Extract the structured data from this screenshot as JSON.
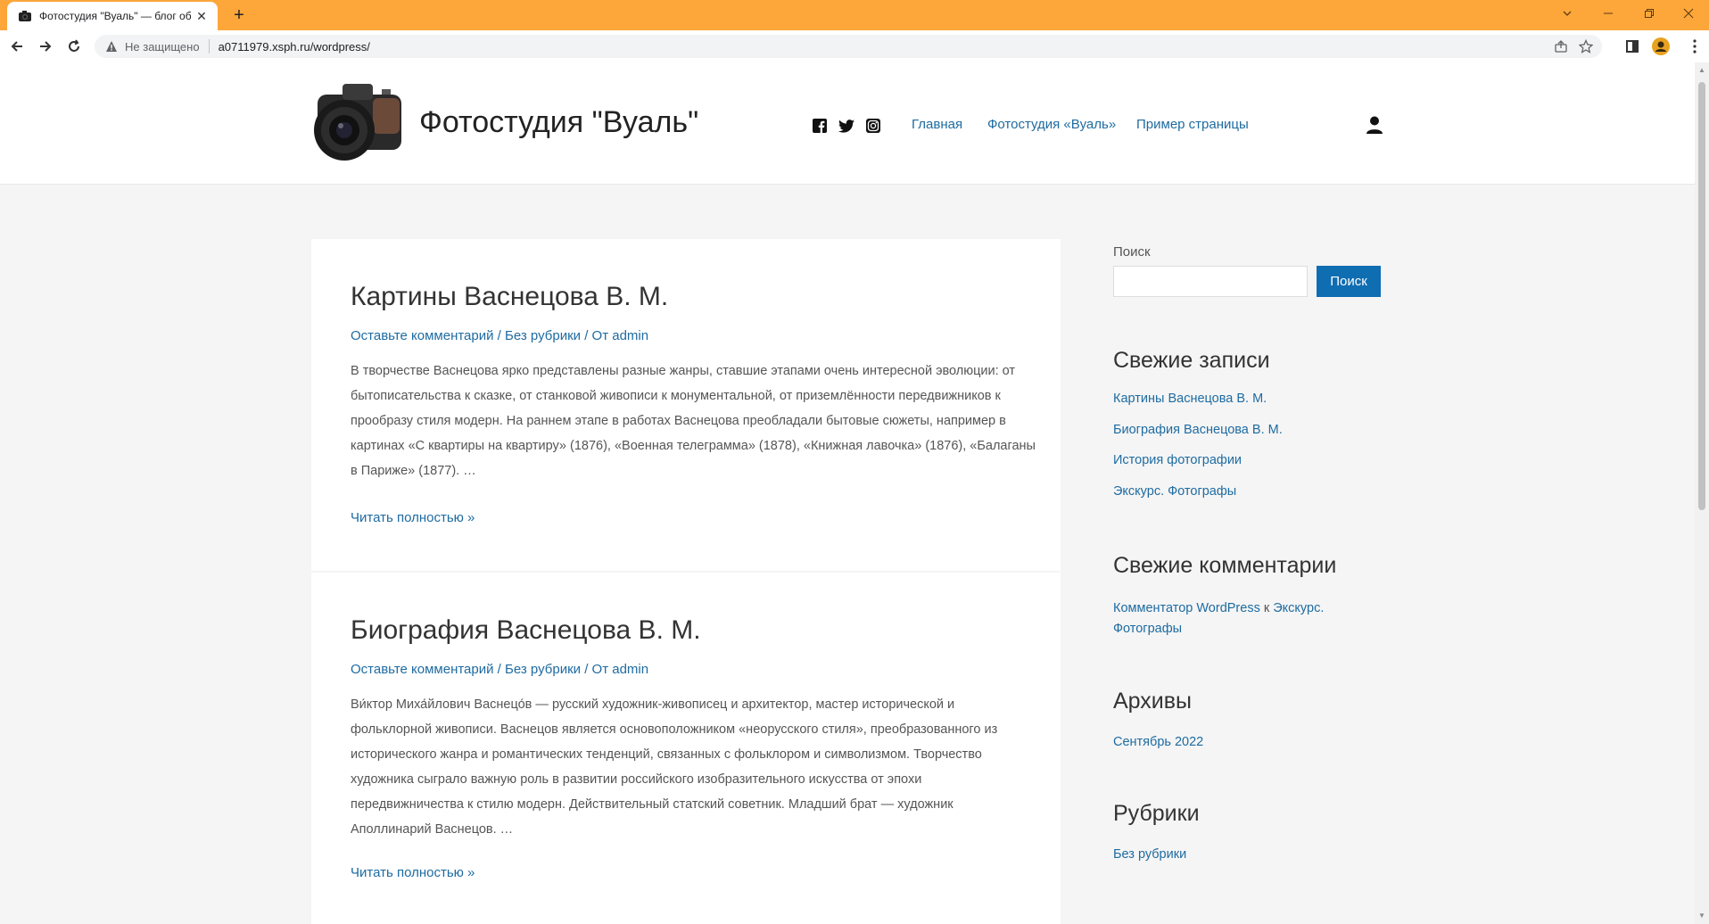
{
  "browser": {
    "tab_title": "Фотостудия \"Вуаль\" — блог об",
    "security_text": "Не защищено",
    "url": "a0711979.xsph.ru/wordpress/"
  },
  "site": {
    "title": "Фотостудия \"Вуаль\"",
    "menu": [
      {
        "label": "Главная"
      },
      {
        "label": "Фотостудия «Вуаль»"
      },
      {
        "label": "Пример страницы"
      }
    ],
    "social_icons": [
      "facebook-icon",
      "twitter-icon",
      "instagram-icon"
    ]
  },
  "posts": [
    {
      "title": "Картины Васнецова В. М.",
      "meta": {
        "comments": "Оставьте комментарий",
        "sep1": " / ",
        "category": "Без рубрики",
        "sep2": " / От ",
        "author": "admin"
      },
      "excerpt": "В творчестве Васнецова ярко представлены разные жанры, ставшие этапами очень интересной эволюции: от бытописательства к сказке, от станковой живописи к монументальной, от приземлённости передвижников к прообразу стиля модерн. На раннем этапе в работах Васнецова преобладали бытовые сюжеты, например в картинах «С квартиры на квартиру» (1876), «Военная телеграмма» (1878), «Книжная лавочка» (1876), «Балаганы в Париже» (1877). …",
      "read_more": "Читать полностью »"
    },
    {
      "title": "Биография Васнецова В. М.",
      "meta": {
        "comments": "Оставьте комментарий",
        "sep1": " / ",
        "category": "Без рубрики",
        "sep2": " / От ",
        "author": "admin"
      },
      "excerpt": "Ви́ктор Миха́йлович Васнецо́в — русский художник-живописец и архитектор, мастер исторической и фольклорной живописи. Васнецов является основоположником «неорусского стиля», преобразованного из исторического жанра и романтических тенденций, связанных с фольклором и символизмом. Творчество художника сыграло важную роль в развитии российского изобразительного искусства от эпохи передвижничества к стилю модерн. Действительный статский советник. Младший брат — художник Аполлинарий Васнецов. …",
      "read_more": "Читать полностью »"
    }
  ],
  "sidebar": {
    "search_label": "Поиск",
    "search_value": "",
    "search_button": "Поиск",
    "recent_posts_title": "Свежие записи",
    "recent_posts": [
      {
        "label": "Картины Васнецова В. М."
      },
      {
        "label": "Биография Васнецова В. М."
      },
      {
        "label": "История фотографии"
      },
      {
        "label": "Экскурс. Фотографы"
      }
    ],
    "recent_comments_title": "Свежие комментарии",
    "recent_comment": {
      "author": "Комментатор WordPress",
      "connector": " к ",
      "post": "Экскурс. Фотографы"
    },
    "archives_title": "Архивы",
    "archives": [
      {
        "label": "Сентябрь 2022"
      }
    ],
    "categories_title": "Рубрики",
    "categories": [
      {
        "label": "Без рубрики"
      }
    ]
  },
  "colors": {
    "titlebar": "#fda63a",
    "link": "#1e6ba1",
    "button": "#0f6db2"
  }
}
